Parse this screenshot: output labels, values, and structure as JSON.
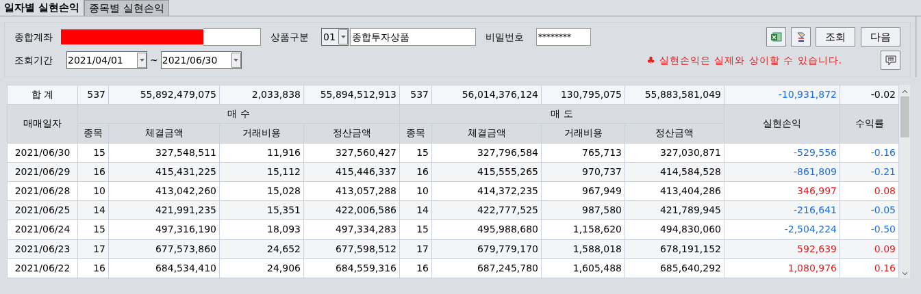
{
  "tabs": [
    {
      "label": "일자별 실현손익",
      "selected": true
    },
    {
      "label": "종목별 실현손익",
      "selected": false
    }
  ],
  "form": {
    "account_label": "종합계좌",
    "product_label": "상품구분",
    "product_code": "01",
    "product_name": "종합투자상품",
    "password_label": "비밀번호",
    "password_value": "********",
    "period_label": "조회기간",
    "date_from": "2021/04/01",
    "date_sep": "~",
    "date_to": "2021/06/30",
    "query_button": "조회",
    "next_button": "다음",
    "notice_mark": "♣",
    "notice": "실현손익은 실제와 상이할 수 있습니다."
  },
  "table": {
    "total": {
      "label": "합 계",
      "cells": [
        "537",
        "55,892,479,075",
        "2,033,838",
        "55,894,512,913",
        "537",
        "56,014,376,124",
        "130,795,075",
        "55,883,581,049"
      ],
      "profit": "-10,931,872",
      "rate": "-0.02",
      "color": "#1a6fe0"
    },
    "date_header": "매매일자",
    "buy_header": "매 수",
    "sell_header": "매 도",
    "profit_header": "실현손익",
    "rate_header": "수익률",
    "sub_headers": [
      "종목",
      "체결금액",
      "거래비용",
      "정산금액",
      "종목",
      "체결금액",
      "거래비용",
      "정산금액"
    ],
    "rows": [
      {
        "date": "2021/06/30",
        "cells": [
          "15",
          "327,548,511",
          "11,916",
          "327,560,427",
          "15",
          "327,796,584",
          "765,713",
          "327,030,871"
        ],
        "profit": "-529,556",
        "rate": "-0.16",
        "color": "#1a6fe0"
      },
      {
        "date": "2021/06/29",
        "cells": [
          "16",
          "415,431,225",
          "15,112",
          "415,446,337",
          "16",
          "415,555,265",
          "970,737",
          "414,584,528"
        ],
        "profit": "-861,809",
        "rate": "-0.21",
        "color": "#1a6fe0"
      },
      {
        "date": "2021/06/28",
        "cells": [
          "10",
          "413,042,260",
          "15,028",
          "413,057,288",
          "10",
          "414,372,235",
          "967,949",
          "413,404,286"
        ],
        "profit": "346,997",
        "rate": "0.08",
        "color": "#e02020"
      },
      {
        "date": "2021/06/25",
        "cells": [
          "14",
          "421,991,235",
          "15,351",
          "422,006,586",
          "14",
          "422,777,525",
          "987,580",
          "421,789,945"
        ],
        "profit": "-216,641",
        "rate": "-0.05",
        "color": "#1a6fe0"
      },
      {
        "date": "2021/06/24",
        "cells": [
          "15",
          "497,316,190",
          "18,093",
          "497,334,283",
          "15",
          "495,988,680",
          "1,158,620",
          "494,830,060"
        ],
        "profit": "-2,504,224",
        "rate": "-0.50",
        "color": "#1a6fe0"
      },
      {
        "date": "2021/06/23",
        "cells": [
          "17",
          "677,573,860",
          "24,652",
          "677,598,512",
          "17",
          "679,779,170",
          "1,588,018",
          "678,191,152"
        ],
        "profit": "592,639",
        "rate": "0.09",
        "color": "#e02020"
      },
      {
        "date": "2021/06/22",
        "cells": [
          "16",
          "684,534,410",
          "24,906",
          "684,559,316",
          "16",
          "687,245,780",
          "1,605,488",
          "685,640,292"
        ],
        "profit": "1,080,976",
        "rate": "0.16",
        "color": "#e02020"
      }
    ]
  }
}
